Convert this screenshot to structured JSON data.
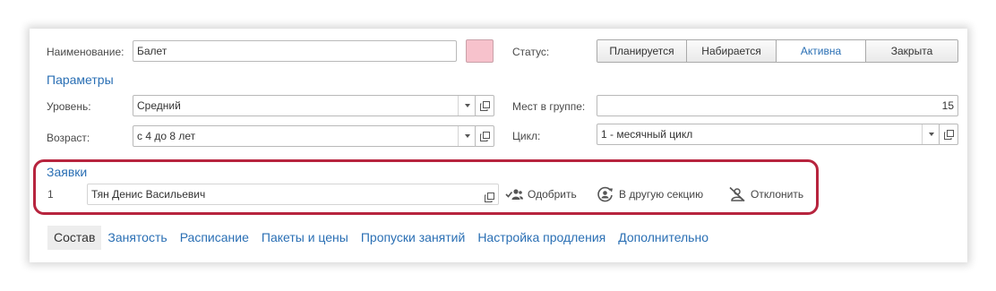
{
  "form": {
    "name_label": "Наименование:",
    "name_value": "Балет",
    "params_title": "Параметры",
    "level_label": "Уровень:",
    "level_value": "Средний",
    "age_label": "Возраст:",
    "age_value": "с 4 до 8 лет",
    "status_label": "Статус:",
    "status_options": [
      "Планируется",
      "Набирается",
      "Активна",
      "Закрыта"
    ],
    "status_selected": "Активна",
    "seats_label": "Мест в группе:",
    "seats_value": "15",
    "cycle_label": "Цикл:",
    "cycle_value": "1 - месячный цикл",
    "color_swatch": "#f7c2cc"
  },
  "requests": {
    "title": "Заявки",
    "rows": [
      {
        "number": "1",
        "name": "Тян Денис Васильевич"
      }
    ],
    "actions": {
      "approve": "Одобрить",
      "other_section": "В другую секцию",
      "reject": "Отклонить"
    }
  },
  "tabs": [
    "Состав",
    "Занятость",
    "Расписание",
    "Пакеты и цены",
    "Пропуски занятий",
    "Настройка продления",
    "Дополнительно"
  ],
  "active_tab": "Состав",
  "colors": {
    "accent": "#2a6fb4",
    "highlight_border": "#b7243e"
  }
}
